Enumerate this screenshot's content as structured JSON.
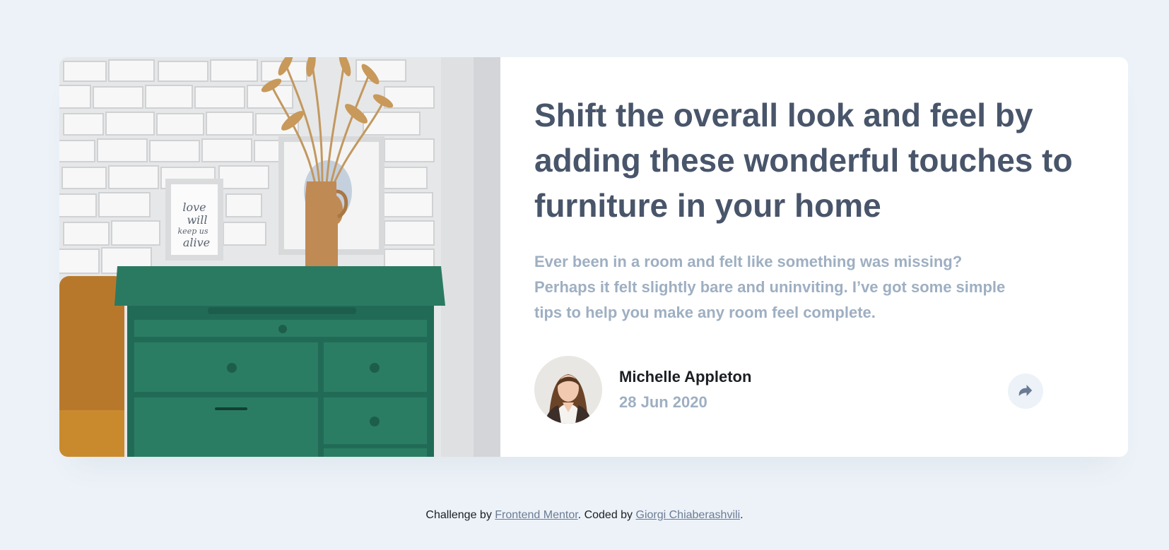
{
  "article": {
    "title": "Shift the overall look and feel by adding these wonderful touches to furniture in your home",
    "description": "Ever been in a room and felt like something was missing? Perhaps it felt slightly bare and uninviting. I’ve got some simple tips to help you make any room feel complete.",
    "author_name": "Michelle Appleton",
    "date": "28 Jun 2020",
    "share_icon": "share-icon",
    "image_icon": "drawers-photo"
  },
  "footer": {
    "prefix": "Challenge by ",
    "link1": "Frontend Mentor",
    "middle": ". Coded by ",
    "link2": "Giorgi Chiaberashvili",
    "suffix": "."
  },
  "colors": {
    "background": "#ecf2f8",
    "title": "#48556a",
    "muted": "#9eafc2",
    "dark": "#1b1f24",
    "share_bg": "#ecf2f8",
    "share_icon": "#6c7b94"
  }
}
